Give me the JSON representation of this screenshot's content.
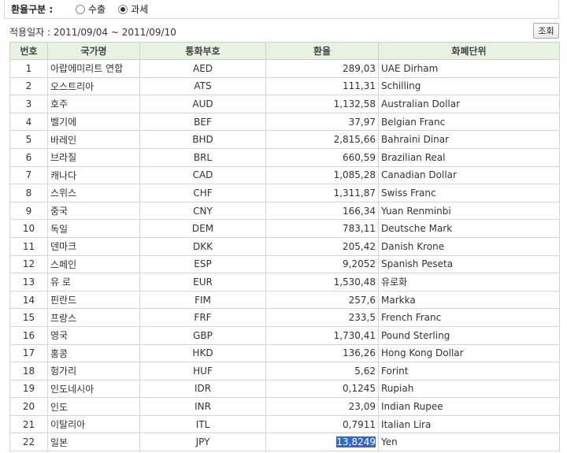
{
  "filter": {
    "label": "환율구분 :",
    "options": [
      {
        "label": "수출",
        "checked": false
      },
      {
        "label": "과세",
        "checked": true
      }
    ]
  },
  "date_range": {
    "prefix": "적용일자 : ",
    "start": "2011/09/04",
    "separator": " ~ ",
    "end": "2011/09/10"
  },
  "search_button": "조회",
  "table": {
    "headers": [
      "번호",
      "국가명",
      "통화부호",
      "환율",
      "화폐단위"
    ],
    "rows": [
      {
        "no": "1",
        "country": "아랍에미리트 연합",
        "code": "AED",
        "rate": "289,03",
        "unit": "UAE Dirham"
      },
      {
        "no": "2",
        "country": "오스트리아",
        "code": "ATS",
        "rate": "111,31",
        "unit": "Schilling"
      },
      {
        "no": "3",
        "country": "호주",
        "code": "AUD",
        "rate": "1,132,58",
        "unit": "Australian Dollar"
      },
      {
        "no": "4",
        "country": "벨기에",
        "code": "BEF",
        "rate": "37,97",
        "unit": "Belgian Franc"
      },
      {
        "no": "5",
        "country": "바레인",
        "code": "BHD",
        "rate": "2,815,66",
        "unit": "Bahraini Dinar"
      },
      {
        "no": "6",
        "country": "브라질",
        "code": "BRL",
        "rate": "660,59",
        "unit": "Brazilian Real"
      },
      {
        "no": "7",
        "country": "캐나다",
        "code": "CAD",
        "rate": "1,085,28",
        "unit": "Canadian Dollar"
      },
      {
        "no": "8",
        "country": "스위스",
        "code": "CHF",
        "rate": "1,311,87",
        "unit": "Swiss Franc"
      },
      {
        "no": "9",
        "country": "중국",
        "code": "CNY",
        "rate": "166,34",
        "unit": "Yuan Renminbi"
      },
      {
        "no": "10",
        "country": "독일",
        "code": "DEM",
        "rate": "783,11",
        "unit": "Deutsche Mark"
      },
      {
        "no": "11",
        "country": "덴마크",
        "code": "DKK",
        "rate": "205,42",
        "unit": "Danish Krone"
      },
      {
        "no": "12",
        "country": "스페인",
        "code": "ESP",
        "rate": "9,2052",
        "unit": "Spanish Peseta"
      },
      {
        "no": "13",
        "country": "유 로",
        "code": "EUR",
        "rate": "1,530,48",
        "unit": "유로화"
      },
      {
        "no": "14",
        "country": "핀란드",
        "code": "FIM",
        "rate": "257,6",
        "unit": "Markka"
      },
      {
        "no": "15",
        "country": "프랑스",
        "code": "FRF",
        "rate": "233,5",
        "unit": "French Franc"
      },
      {
        "no": "16",
        "country": "영국",
        "code": "GBP",
        "rate": "1,730,41",
        "unit": "Pound Sterling"
      },
      {
        "no": "17",
        "country": "홍콩",
        "code": "HKD",
        "rate": "136,26",
        "unit": "Hong Kong Dollar"
      },
      {
        "no": "18",
        "country": "헝가리",
        "code": "HUF",
        "rate": "5,62",
        "unit": "Forint"
      },
      {
        "no": "19",
        "country": "인도네시아",
        "code": "IDR",
        "rate": "0,1245",
        "unit": "Rupiah"
      },
      {
        "no": "20",
        "country": "인도",
        "code": "INR",
        "rate": "23,09",
        "unit": "Indian Rupee"
      },
      {
        "no": "21",
        "country": "이탈리아",
        "code": "ITL",
        "rate": "0,7911",
        "unit": "Italian Lira"
      },
      {
        "no": "22",
        "country": "일본",
        "code": "JPY",
        "rate": "13,8249",
        "unit": "Yen",
        "rate_selected": true
      }
    ]
  },
  "colors": {
    "header_bg": "#e8f2e3",
    "selection_bg": "#3366cc"
  }
}
